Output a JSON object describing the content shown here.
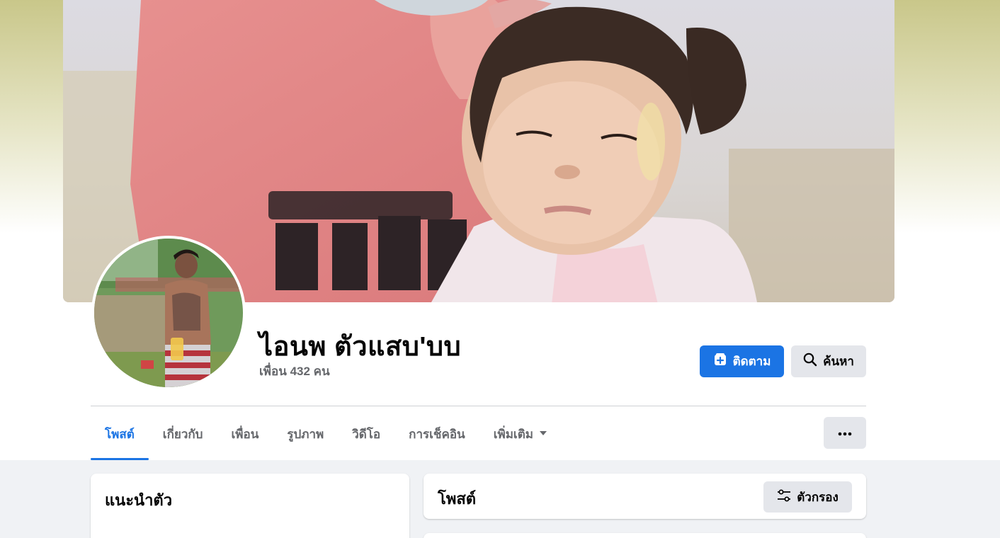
{
  "profile": {
    "name": "ไอนพ ตัวแสบ'บบ",
    "friends": "เพื่อน 432 คน"
  },
  "actions": {
    "follow_label": "ติดตาม",
    "search_label": "ค้นหา"
  },
  "tabs": [
    {
      "label": "โพสต์",
      "active": true
    },
    {
      "label": "เกี่ยวกับ"
    },
    {
      "label": "เพื่อน"
    },
    {
      "label": "รูปภาพ"
    },
    {
      "label": "วิดีโอ"
    },
    {
      "label": "การเช็คอิน"
    },
    {
      "label": "เพิ่มเติม"
    }
  ],
  "intro": {
    "title": "แนะนำตัว"
  },
  "posts": {
    "title": "โพสต์",
    "filter_label": "ตัวกรอง"
  },
  "colors": {
    "accent": "#1b74e4",
    "button_gray": "#e4e6eb",
    "page_bg": "#f0f2f5"
  },
  "icons": {
    "follow": "follow-plus-icon",
    "search": "search-icon",
    "dropdown": "chevron-down-icon",
    "more": "more-dots-icon",
    "filter": "filter-sliders-icon"
  }
}
